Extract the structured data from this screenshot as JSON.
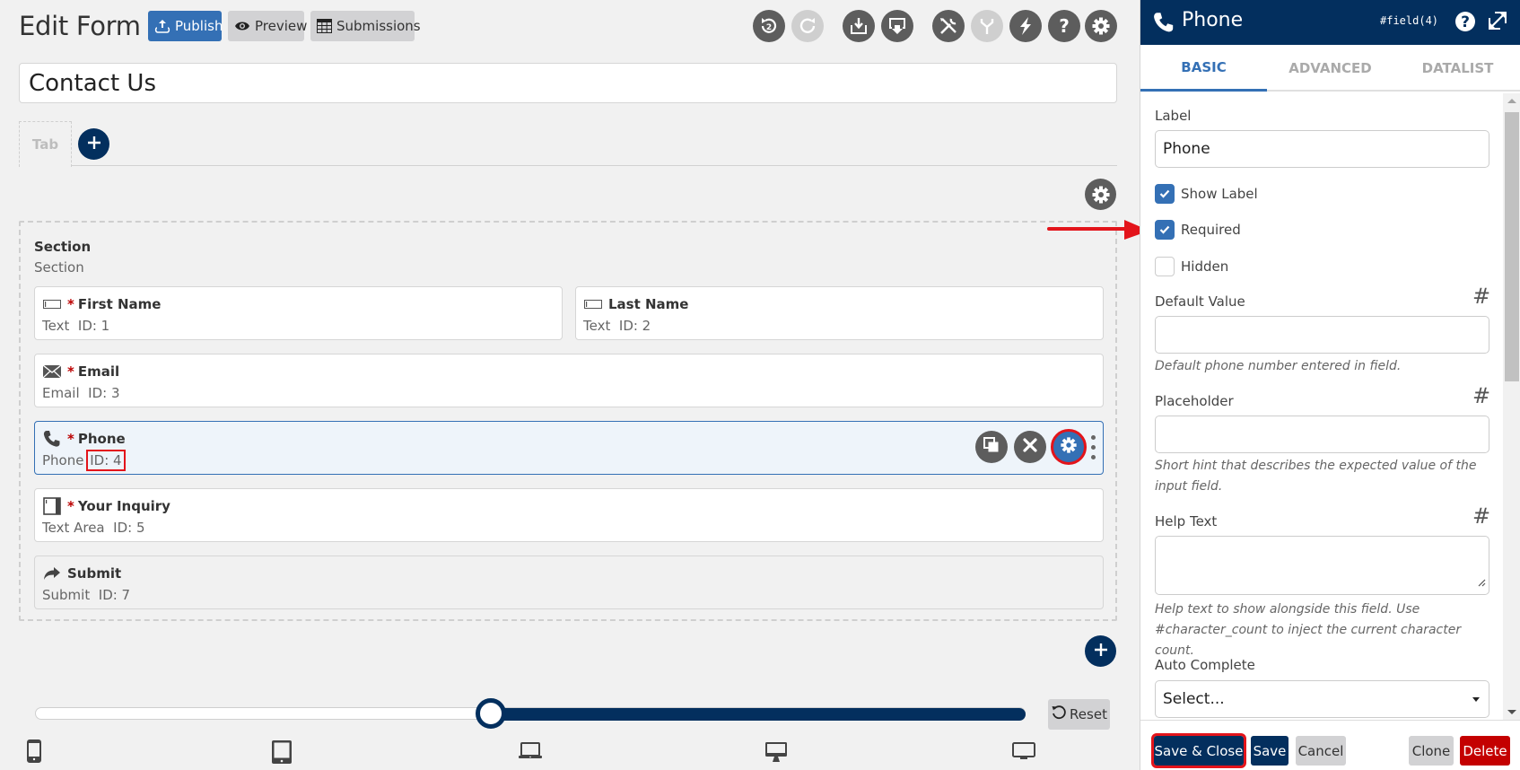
{
  "header": {
    "title": "Edit Form",
    "buttons": {
      "publish": "Publish",
      "preview": "Preview",
      "submissions": "Submissions"
    },
    "toolbar_icons": [
      {
        "name": "undo-icon",
        "badge": "2",
        "enabled": true
      },
      {
        "name": "redo-icon",
        "enabled": false
      },
      {
        "name": "import-icon",
        "enabled": true
      },
      {
        "name": "export-icon",
        "enabled": true
      },
      {
        "name": "tools-icon",
        "enabled": true
      },
      {
        "name": "fork-icon",
        "enabled": false
      },
      {
        "name": "lightning-icon",
        "enabled": true
      },
      {
        "name": "help-icon",
        "enabled": true
      },
      {
        "name": "gear-icon",
        "enabled": true
      }
    ]
  },
  "form": {
    "name": "Contact Us",
    "tab_label": "Tab",
    "section": {
      "title": "Section",
      "subtitle": "Section"
    },
    "fields": [
      {
        "label": "First Name",
        "type": "Text",
        "id": "ID: 1",
        "required": true,
        "icon": "text-field-icon"
      },
      {
        "label": "Last Name",
        "type": "Text",
        "id": "ID: 2",
        "required": false,
        "icon": "text-field-icon"
      },
      {
        "label": "Email",
        "type": "Email",
        "id": "ID: 3",
        "required": true,
        "icon": "envelope-icon"
      },
      {
        "label": "Phone",
        "type": "Phone",
        "id": "ID: 4",
        "required": true,
        "icon": "phone-icon",
        "selected": true
      },
      {
        "label": "Your Inquiry",
        "type": "Text Area",
        "id": "ID: 5",
        "required": true,
        "icon": "textarea-icon"
      },
      {
        "label": "Submit",
        "type": "Submit",
        "id": "ID: 7",
        "required": false,
        "icon": "share-arrow-icon"
      }
    ],
    "required_marker": "*"
  },
  "breakpoint_slider": {
    "value_fraction": 0.46,
    "reset_label": "Reset",
    "devices": [
      "mobile-icon",
      "tablet-icon",
      "laptop-icon",
      "desktop-icon",
      "large-screen-icon"
    ]
  },
  "panel": {
    "title": "Phone",
    "field_ref": "#field(4)",
    "tabs": [
      {
        "label": "BASIC",
        "active": true
      },
      {
        "label": "ADVANCED",
        "active": false
      },
      {
        "label": "DATALIST",
        "active": false
      }
    ],
    "label_field": {
      "label": "Label",
      "value": "Phone"
    },
    "checkboxes": [
      {
        "label": "Show Label",
        "checked": true
      },
      {
        "label": "Required",
        "checked": true
      },
      {
        "label": "Hidden",
        "checked": false
      }
    ],
    "default_value": {
      "label": "Default Value",
      "value": "",
      "hint": "Default phone number entered in field."
    },
    "placeholder": {
      "label": "Placeholder",
      "value": "",
      "hint": "Short hint that describes the expected value of the input field."
    },
    "help_text": {
      "label": "Help Text",
      "value": "",
      "hint": "Help text to show alongside this field. Use #character_count to inject the current character count."
    },
    "auto_complete": {
      "label": "Auto Complete",
      "selected": "Select..."
    },
    "hash_symbol": "#",
    "footer": {
      "save_close": "Save & Close",
      "save": "Save",
      "cancel": "Cancel",
      "clone": "Clone",
      "delete": "Delete"
    }
  },
  "colors": {
    "brand_navy": "#032f5e",
    "accent_blue": "#3470b5",
    "danger_red": "#c40000",
    "annotation_red": "#e3141b",
    "required_red": "#bb0000"
  }
}
